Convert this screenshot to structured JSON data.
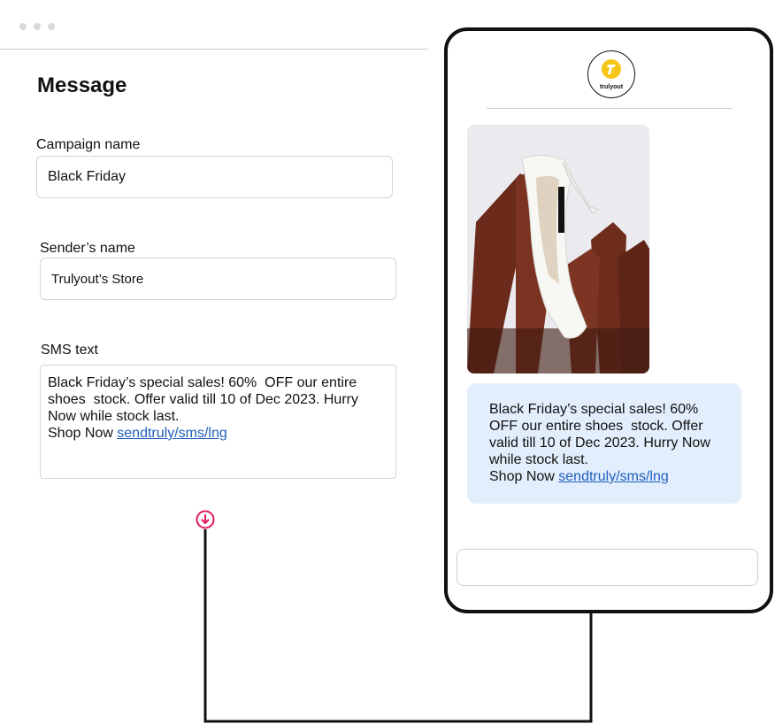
{
  "form": {
    "title": "Message",
    "campaign": {
      "label": "Campaign name",
      "value": "Black Friday"
    },
    "sender": {
      "label": "Sender’s name",
      "value": "Trulyout’s Store"
    },
    "sms": {
      "label": "SMS text",
      "body": "Black Friday’s special sales! 60%  OFF our entire shoes  stock. Offer valid till 10 of Dec 2023. Hurry Now while stock last.\nShop Now ",
      "link": "sendtruly/sms/lng"
    }
  },
  "preview": {
    "logo_text": "trulyout",
    "message_body": "Black Friday’s special sales! 60% OFF our entire shoes  stock. Offer valid till 10 of Dec 2023. Hurry Now while stock last.\nShop Now ",
    "message_link": "sendtruly/sms/lng"
  },
  "colors": {
    "accent_pink": "#e2195b",
    "logo_yellow": "#f5c518",
    "bubble_bg": "#e3eefc",
    "link": "#1f5fbf"
  }
}
